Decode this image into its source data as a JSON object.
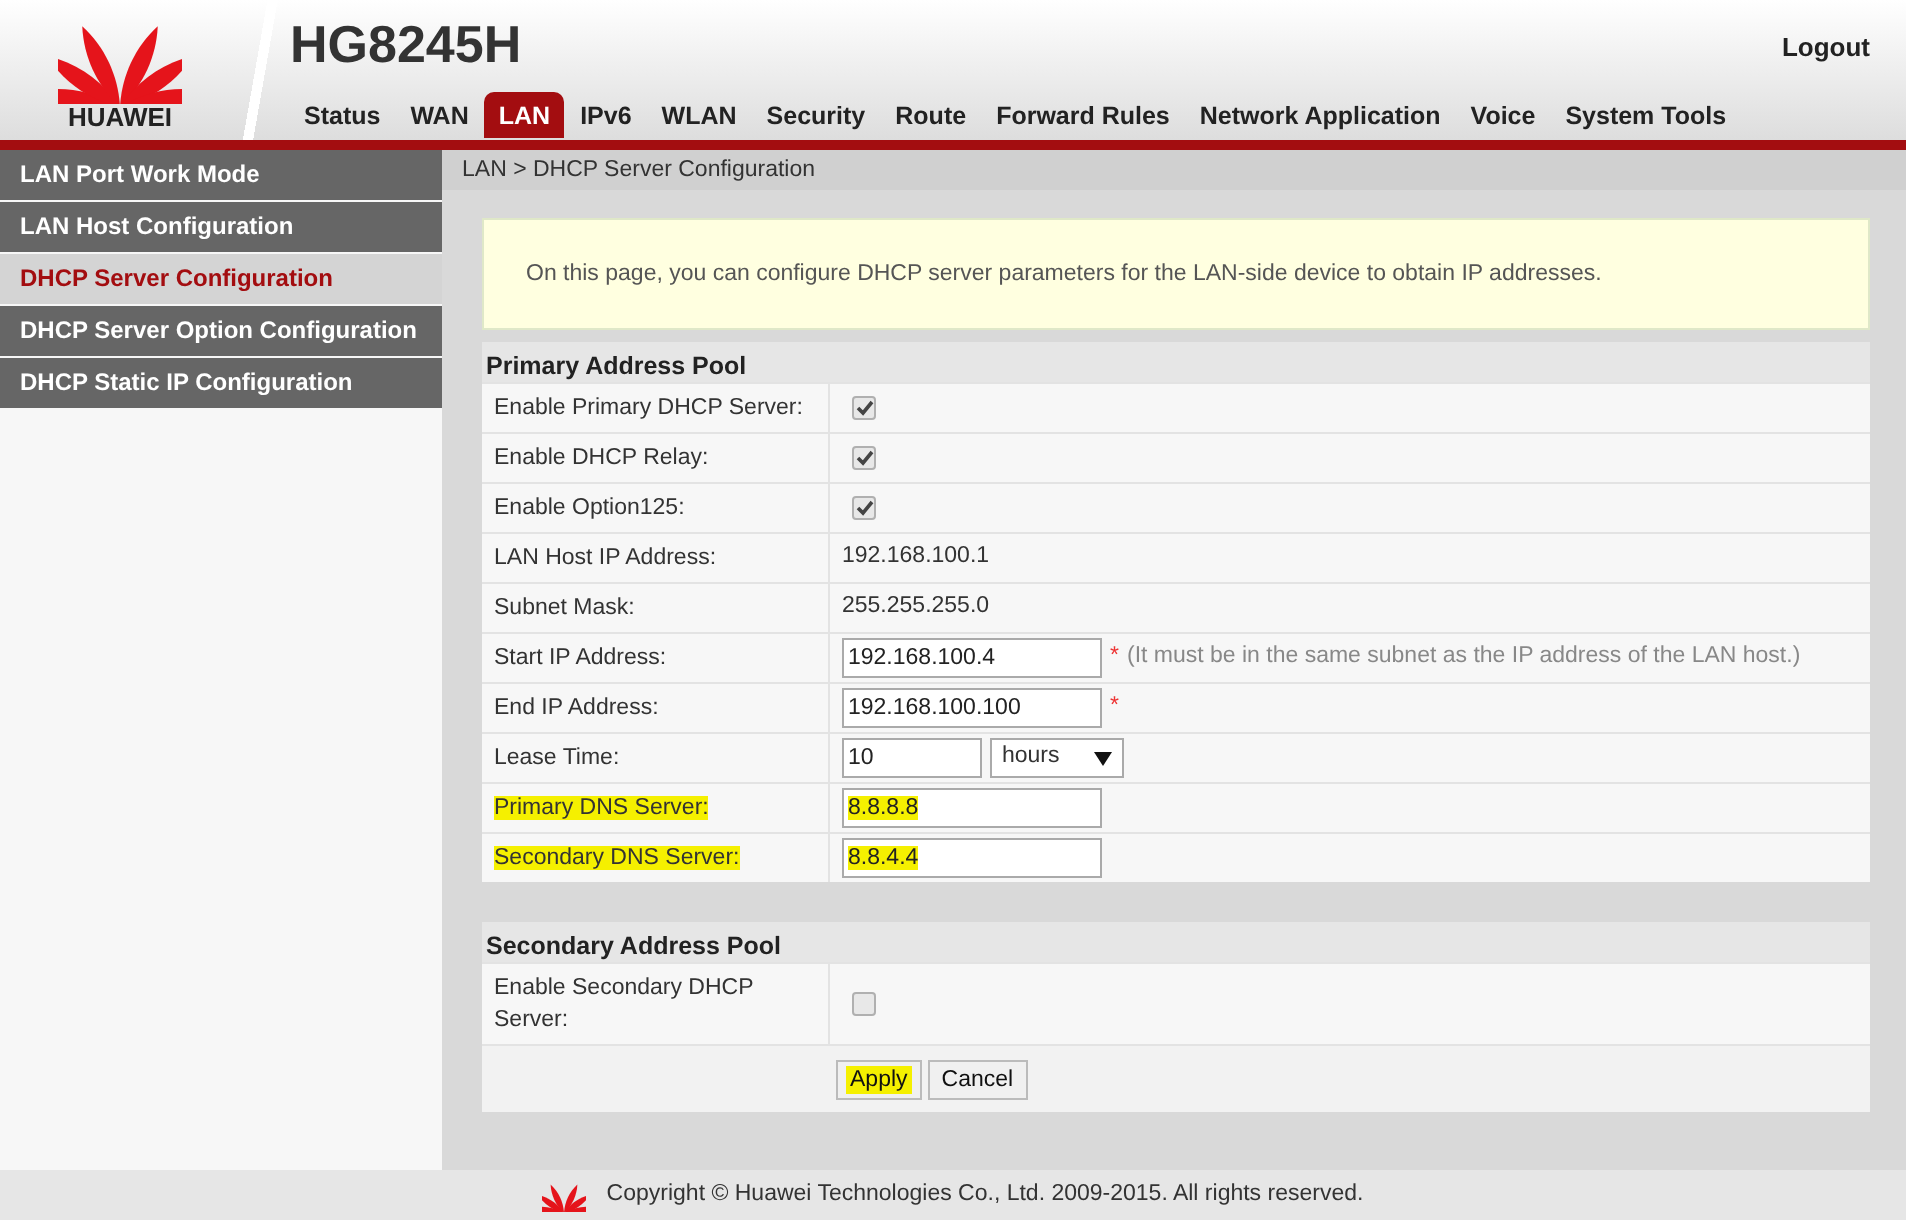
{
  "header": {
    "brand": "HUAWEI",
    "model": "HG8245H",
    "logout": "Logout"
  },
  "nav": [
    {
      "label": "Status",
      "selected": false
    },
    {
      "label": "WAN",
      "selected": false
    },
    {
      "label": "LAN",
      "selected": true
    },
    {
      "label": "IPv6",
      "selected": false
    },
    {
      "label": "WLAN",
      "selected": false
    },
    {
      "label": "Security",
      "selected": false
    },
    {
      "label": "Route",
      "selected": false
    },
    {
      "label": "Forward Rules",
      "selected": false
    },
    {
      "label": "Network Application",
      "selected": false
    },
    {
      "label": "Voice",
      "selected": false
    },
    {
      "label": "System Tools",
      "selected": false
    }
  ],
  "sidebar": {
    "items": [
      {
        "label": "LAN Port Work Mode",
        "selected": false
      },
      {
        "label": "LAN Host Configuration",
        "selected": false
      },
      {
        "label": "DHCP Server Configuration",
        "selected": true
      },
      {
        "label": "DHCP Server Option Configuration",
        "selected": false
      },
      {
        "label": "DHCP Static IP Configuration",
        "selected": false
      }
    ]
  },
  "breadcrumb": "LAN > DHCP Server Configuration",
  "info": "On this page, you can configure DHCP server parameters for the LAN-side device to obtain IP addresses.",
  "sections": [
    {
      "title": "Primary Address Pool",
      "rows": [
        {
          "kind": "checkbox",
          "label": "Enable Primary DHCP Server:",
          "checked": true,
          "highlighted": false
        },
        {
          "kind": "checkbox",
          "label": "Enable DHCP Relay:",
          "checked": true,
          "highlighted": false
        },
        {
          "kind": "checkbox",
          "label": "Enable Option125:",
          "checked": true,
          "highlighted": false
        },
        {
          "kind": "text",
          "label": "LAN Host IP Address:",
          "value": "192.168.100.1",
          "highlighted": false
        },
        {
          "kind": "text",
          "label": "Subnet Mask:",
          "value": "255.255.255.0",
          "highlighted": false
        },
        {
          "kind": "input",
          "label": "Start IP Address:",
          "value": "192.168.100.4",
          "required_mark": "*",
          "note": "(It must be in the same subnet as the IP address of the LAN host.)",
          "highlighted": false
        },
        {
          "kind": "input",
          "label": "End IP Address:",
          "value": "192.168.100.100",
          "required_mark": "*",
          "highlighted": false
        },
        {
          "kind": "lease",
          "label": "Lease Time:",
          "value": "10",
          "unit": "hours",
          "highlighted": false
        },
        {
          "kind": "input",
          "label": "Primary DNS Server:",
          "value": "8.8.8.8",
          "highlighted": true
        },
        {
          "kind": "input",
          "label": "Secondary DNS Server:",
          "value": "8.8.4.4",
          "highlighted": true
        }
      ]
    },
    {
      "title": "Secondary Address Pool",
      "rows": [
        {
          "kind": "checkbox",
          "label": "Enable Secondary DHCP Server:",
          "checked": false,
          "highlighted": false
        }
      ]
    }
  ],
  "buttons": [
    {
      "label": "Apply",
      "highlighted": true
    },
    {
      "label": "Cancel",
      "highlighted": false
    }
  ],
  "footer": "Copyright © Huawei Technologies Co., Ltd. 2009-2015. All rights reserved."
}
